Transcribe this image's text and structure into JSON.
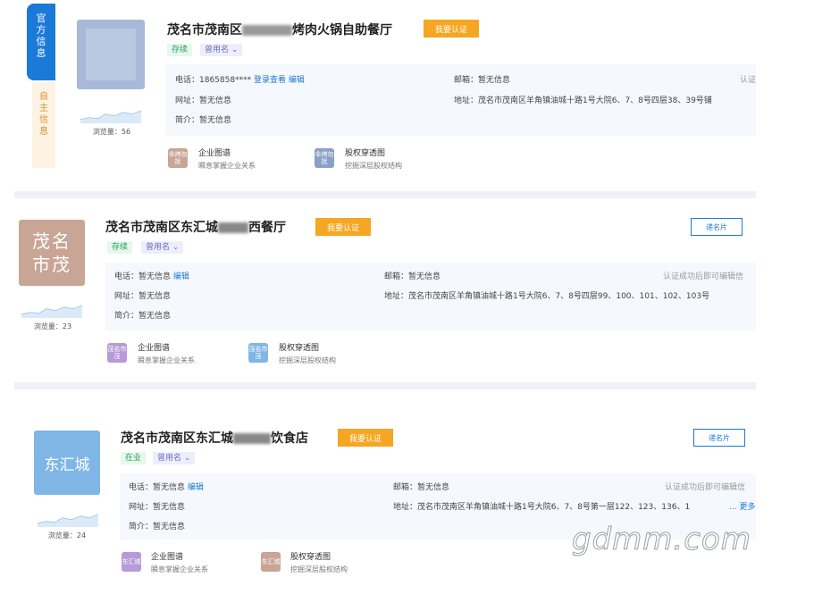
{
  "card1": {
    "side_tab_official": "官方信息",
    "side_tab_self": "自主信息",
    "title_part1": "茂名市茂南区",
    "title_part2": "烤肉火锅自助餐厅",
    "verify_btn": "我要认证",
    "status": "存续",
    "former_name": "曾用名 ⌄",
    "phone_label": "电话：1865858****",
    "phone_link": "登录查看",
    "phone_edit": "编辑",
    "email": "邮箱：暂无信息",
    "verify_hint": "认证",
    "website": "网址：暂无信息",
    "address": "地址：茂名市茂南区羊角镇油城十路1号大院6、7、8号四层38、39号铺",
    "intro": "简介：暂无信息",
    "views": "浏览量：56",
    "feat1_icon": "非烤勿扰",
    "feat1_title": "企业图谱",
    "feat1_sub": "瞬息掌握企业关系",
    "feat2_icon": "非烤勿扰",
    "feat2_title": "股权穿透图",
    "feat2_sub": "挖掘深层股权结构"
  },
  "card2": {
    "logo_text": "茂名市茂",
    "title_part1": "茂名市茂南区东汇城",
    "title_part2": "西餐厅",
    "verify_btn": "我要认证",
    "name_card_btn": "递名片",
    "status": "存续",
    "former_name": "曾用名 ⌄",
    "phone_label": "电话：暂无信息",
    "phone_edit": "编辑",
    "email": "邮箱：暂无信息",
    "verify_hint": "认证成功后即可编辑信",
    "website": "网址：暂无信息",
    "address": "地址：茂名市茂南区羊角镇油城十路1号大院6、7、8号四层99、100、101、102、103号",
    "intro": "简介：暂无信息",
    "views": "浏览量：23",
    "feat1_icon": "茂名市茂",
    "feat1_title": "企业图谱",
    "feat1_sub": "瞬息掌握企业关系",
    "feat2_icon": "茂名市茂",
    "feat2_title": "股权穿透图",
    "feat2_sub": "挖掘深层股权结构"
  },
  "card3": {
    "logo_text": "东汇城",
    "title_part1": "茂名市茂南区东汇城",
    "title_part2": "饮食店",
    "verify_btn": "我要认证",
    "name_card_btn": "递名片",
    "status": "在业",
    "former_name": "曾用名 ⌄",
    "phone_label": "电话：暂无信息",
    "phone_edit": "编辑",
    "email": "邮箱：暂无信息",
    "verify_hint": "认证成功后即可编辑信",
    "website": "网址：暂无信息",
    "address": "地址：茂名市茂南区羊角镇油城十路1号大院6、7、8号第一层122、123、136、1",
    "more": "... 更多",
    "intro": "简介：暂无信息",
    "views": "浏览量：24",
    "feat1_icon": "东汇城",
    "feat1_title": "企业图谱",
    "feat1_sub": "瞬息掌握企业关系",
    "feat2_icon": "东汇城",
    "feat2_title": "股权穿透图",
    "feat2_sub": "挖掘深层股权结构"
  },
  "watermark": "gdmm.com",
  "colors": {
    "accent_blue": "#1b79d8",
    "verify_orange": "#f5a623",
    "logo2": "#c9a596",
    "logo3": "#7fb6e6"
  }
}
